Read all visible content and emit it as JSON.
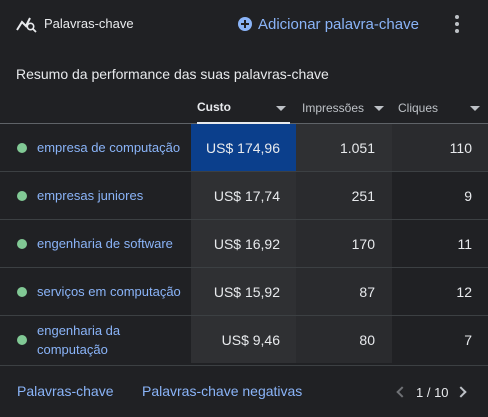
{
  "header": {
    "title": "Palavras-chave",
    "add_label": "Adicionar palavra-chave",
    "logo_icon": "keyword-trend-icon",
    "more_icon": "more-vert-icon"
  },
  "subtitle": "Resumo da performance das suas palavras-chave",
  "table": {
    "columns": [
      {
        "label": "Custo",
        "sorted": true
      },
      {
        "label": "Impressões",
        "sorted": false
      },
      {
        "label": "Cliques",
        "sorted": false
      }
    ],
    "rows": [
      {
        "keyword": "empresa de computação",
        "status_color": "#81c995",
        "cost": "US$ 174,96",
        "impressions": "1.051",
        "clicks": "110"
      },
      {
        "keyword": "empresas juniores",
        "status_color": "#81c995",
        "cost": "US$ 17,74",
        "impressions": "251",
        "clicks": "9"
      },
      {
        "keyword": "engenharia de software",
        "status_color": "#81c995",
        "cost": "US$ 16,92",
        "impressions": "170",
        "clicks": "11"
      },
      {
        "keyword": "serviços em computação",
        "status_color": "#81c995",
        "cost": "US$ 15,92",
        "impressions": "87",
        "clicks": "12"
      },
      {
        "keyword": "engenharia da computação",
        "status_color": "#81c995",
        "cost": "US$ 9,46",
        "impressions": "80",
        "clicks": "7"
      }
    ]
  },
  "footer": {
    "keywords_link": "Palavras-chave",
    "negative_link": "Palavras-chave negativas",
    "pagination": "1 / 10"
  },
  "colors": {
    "accent": "#8ab4f8",
    "status_enabled": "#81c995",
    "highlight_cell": "#0b3f8c"
  }
}
